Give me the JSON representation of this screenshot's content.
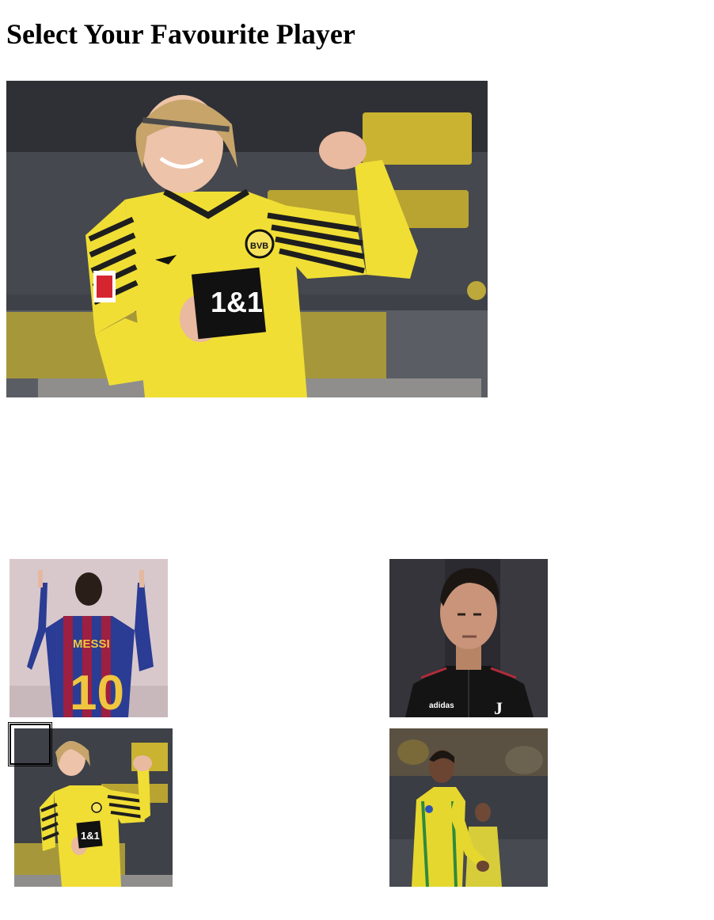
{
  "page": {
    "title": "Select Your Favourite Player"
  },
  "main_image": {
    "alt": "Footballer in yellow BVB 1&1 kit celebrating with clenched fist"
  },
  "thumbnails": [
    {
      "alt": "Footballer seen from behind in blue and red Messi 10 shirt pointing up"
    },
    {
      "alt": "Footballer in black adidas Juventus training top"
    },
    {
      "alt": "Footballer in yellow BVB 1&1 kit celebrating"
    },
    {
      "alt": "Footballer in yellow and green kit running with ball"
    }
  ],
  "colors": {
    "bvb_yellow": "#f2e23a",
    "barca_blue": "#23409a",
    "barca_red": "#a3233f",
    "juve_black": "#151515"
  }
}
